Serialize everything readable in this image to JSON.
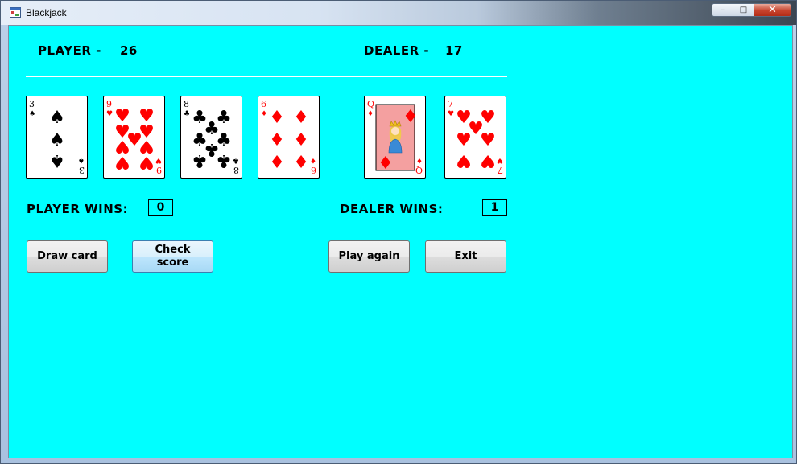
{
  "window": {
    "title": "Blackjack",
    "minimize": "–",
    "maximize": "□",
    "close": "✕"
  },
  "player": {
    "label": "PLAYER  -",
    "score": "26",
    "wins_label": "PLAYER  WINS:",
    "wins": "0"
  },
  "dealer": {
    "label": "DEALER  -",
    "score": "17",
    "wins_label": "DEALER  WINS:",
    "wins": "1"
  },
  "player_cards": [
    {
      "rank": "3",
      "suit": "spades",
      "color": "#000000",
      "symbol": "♠"
    },
    {
      "rank": "9",
      "suit": "hearts",
      "color": "#ff0000",
      "symbol": "♥"
    },
    {
      "rank": "8",
      "suit": "clubs",
      "color": "#000000",
      "symbol": "♣"
    },
    {
      "rank": "6",
      "suit": "diamonds",
      "color": "#ff0000",
      "symbol": "♦"
    }
  ],
  "dealer_cards": [
    {
      "rank": "Q",
      "suit": "diamonds",
      "color": "#ff0000",
      "symbol": "♦"
    },
    {
      "rank": "7",
      "suit": "hearts",
      "color": "#ff0000",
      "symbol": "♥"
    }
  ],
  "buttons": {
    "draw": "Draw card",
    "check_line1": "Check",
    "check_line2": "score",
    "play_again": "Play again",
    "exit": "Exit"
  },
  "colors": {
    "background": "#00ffff",
    "red_suit": "#ff0000",
    "black_suit": "#000000"
  }
}
